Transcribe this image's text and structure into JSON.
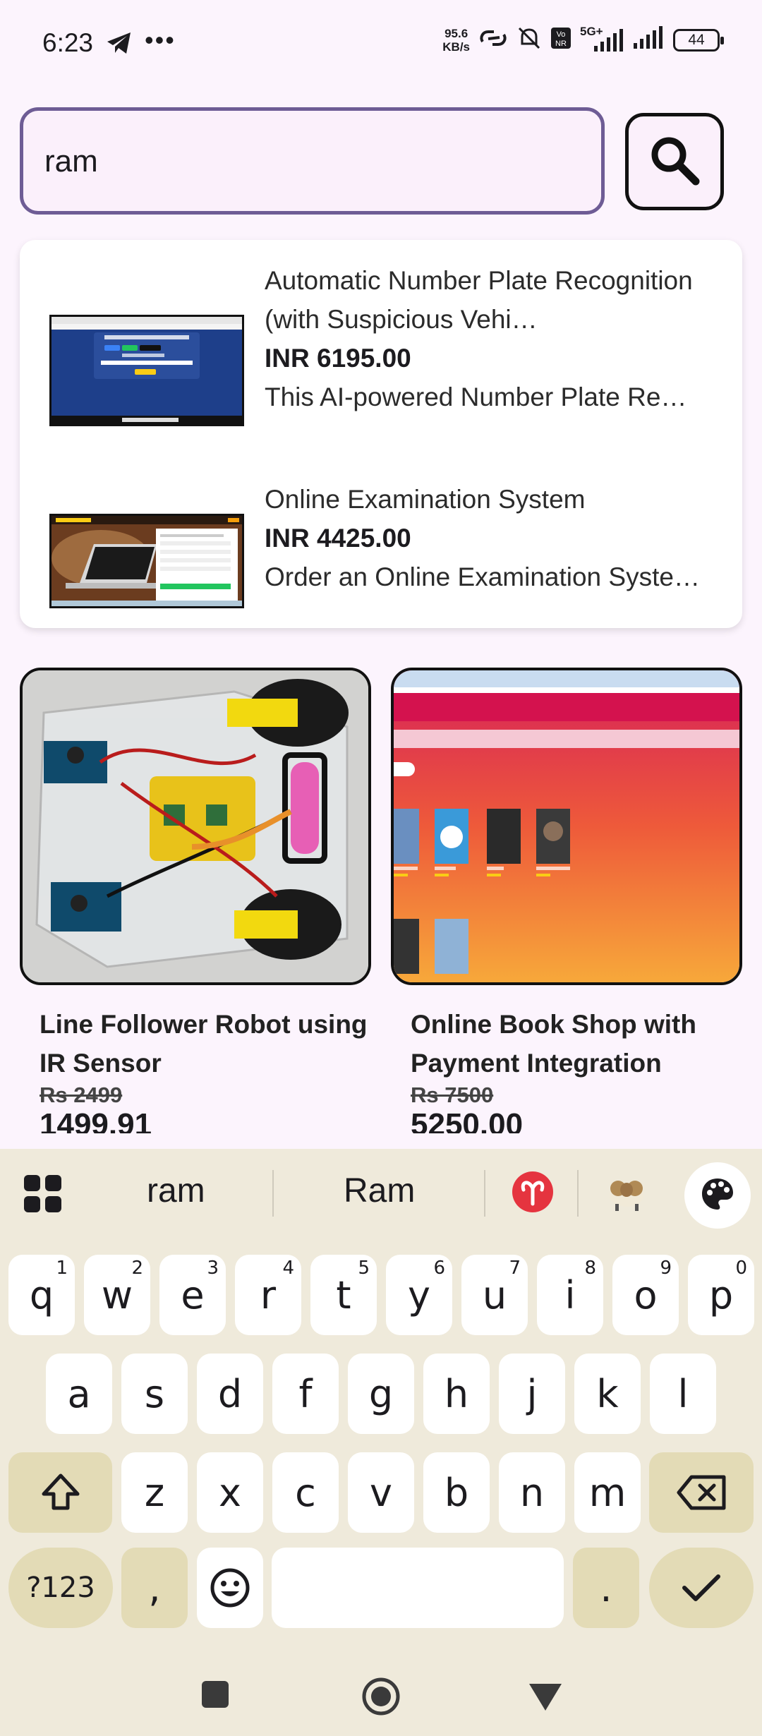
{
  "status_bar": {
    "time": "6:23",
    "more": "•••",
    "net_speed_top": "95.6",
    "net_speed_bottom": "KB/s",
    "network_label": "5G+",
    "battery": "44"
  },
  "search": {
    "value": "ram",
    "placeholder": "",
    "icon": "search-icon"
  },
  "suggestions": [
    {
      "title": "Automatic Number Plate Recognition (with Suspicious Vehi…",
      "price": "INR 6195.00",
      "description": "This AI-powered Number Plate Re…"
    },
    {
      "title": "Online Examination System",
      "price": "INR 4425.00",
      "description": "Order an Online Examination Syste…"
    }
  ],
  "products": [
    {
      "title": "Line Follower Robot using IR Sensor",
      "old_price": "Rs 2499",
      "new_price": "1499.91"
    },
    {
      "title": "Online Book Shop with Payment Integration",
      "old_price": "Rs 7500",
      "new_price": "5250.00"
    }
  ],
  "keyboard": {
    "suggestions": [
      "ram",
      "Ram"
    ],
    "row1": [
      "q",
      "w",
      "e",
      "r",
      "t",
      "y",
      "u",
      "i",
      "o",
      "p"
    ],
    "row1_nums": [
      "1",
      "2",
      "3",
      "4",
      "5",
      "6",
      "7",
      "8",
      "9",
      "0"
    ],
    "row2": [
      "a",
      "s",
      "d",
      "f",
      "g",
      "h",
      "j",
      "k",
      "l"
    ],
    "row3": [
      "z",
      "x",
      "c",
      "v",
      "b",
      "n",
      "m"
    ],
    "symbols": "?123",
    "comma": ",",
    "period": "."
  },
  "colors": {
    "search_border": "#6e5c95",
    "keyboard_bg": "#efeadb",
    "key_dark": "#e3dbb6"
  }
}
